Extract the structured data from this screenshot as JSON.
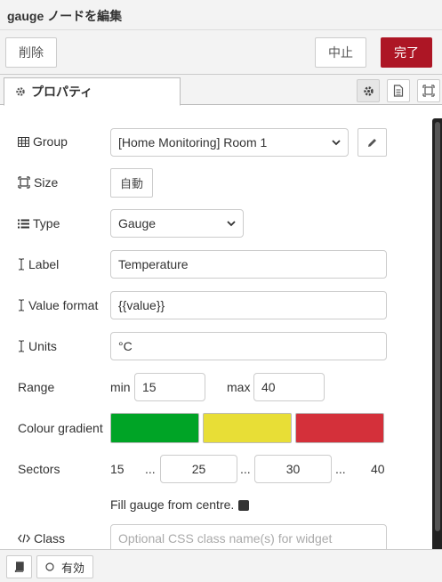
{
  "dialog": {
    "title": "gauge ノードを編集",
    "delete_label": "削除",
    "cancel_label": "中止",
    "done_label": "完了"
  },
  "tabs": {
    "properties_label": "プロパティ"
  },
  "form": {
    "group": {
      "label": "Group",
      "value": "[Home Monitoring] Room 1",
      "icon": "table-icon"
    },
    "size": {
      "label": "Size",
      "value": "自動",
      "icon": "resize-icon"
    },
    "type": {
      "label": "Type",
      "value": "Gauge",
      "icon": "list-icon"
    },
    "label_field": {
      "label": "Label",
      "value": "Temperature",
      "icon": "text-cursor-icon"
    },
    "value_format": {
      "label": "Value format",
      "value": "{{value}}",
      "icon": "text-cursor-icon"
    },
    "units": {
      "label": "Units",
      "value": "°C",
      "icon": "text-cursor-icon"
    },
    "range": {
      "label": "Range",
      "min_label": "min",
      "min_value": "15",
      "max_label": "max",
      "max_value": "40"
    },
    "colour_gradient": {
      "label": "Colour gradient",
      "colors": [
        "#00a426",
        "#e8de36",
        "#d4303a"
      ]
    },
    "sectors": {
      "label": "Sectors",
      "start": "15",
      "dots1": "...",
      "mid1": "25",
      "dots2": "...",
      "mid2": "30",
      "dots3": "...",
      "end": "40"
    },
    "fill_from_centre": {
      "label": "Fill gauge from centre.",
      "checked": true
    },
    "class": {
      "label": "Class",
      "placeholder": "Optional CSS class name(s) for widget",
      "icon": "code-icon"
    }
  },
  "footer": {
    "enabled_label": "有効"
  }
}
